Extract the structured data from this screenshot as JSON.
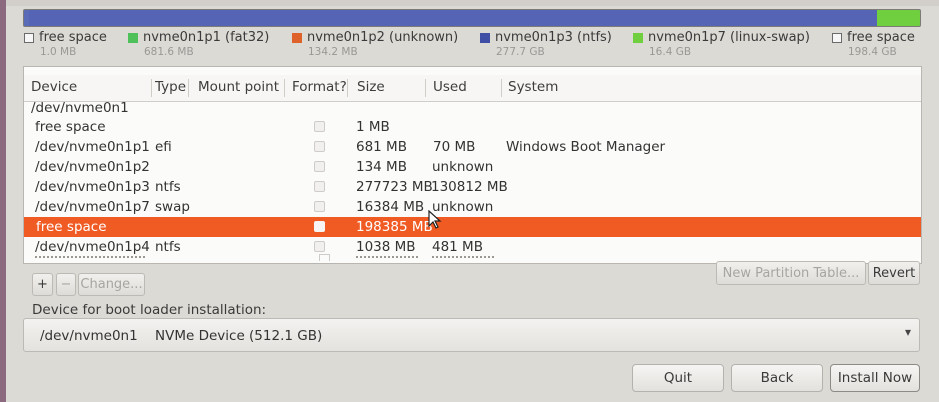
{
  "disk_bar": {
    "segments": [
      {
        "label": "free space",
        "size": "1.0 MB",
        "color": "#f5f5f5",
        "fraction": 0.002
      },
      {
        "label": "nvme0n1p1 (fat32)",
        "size": "681.6 MB",
        "color": "#4fc15a",
        "fraction": 0.002
      },
      {
        "label": "nvme0n1p2 (unknown)",
        "size": "134.2 MB",
        "color": "#e0622b",
        "fraction": 0.001
      },
      {
        "label": "nvme0n1p3 (ntfs)",
        "size": "277.7 GB",
        "color": "#3f4fa6",
        "fraction": 0.946
      },
      {
        "label": "nvme0n1p7 (linux-swap)",
        "size": "16.4 GB",
        "color": "#6fcf3f",
        "fraction": 0.049
      }
    ]
  },
  "legend": [
    {
      "label": "free space",
      "size": "1.0 MB",
      "color": "#f6f6f6"
    },
    {
      "label": "nvme0n1p1 (fat32)",
      "size": "681.6 MB",
      "color": "#4fc15a"
    },
    {
      "label": "nvme0n1p2 (unknown)",
      "size": "134.2 MB",
      "color": "#e0622b"
    },
    {
      "label": "nvme0n1p3 (ntfs)",
      "size": "277.7 GB",
      "color": "#3f4fa6"
    },
    {
      "label": "nvme0n1p7 (linux-swap)",
      "size": "16.4 GB",
      "color": "#6fcf3f"
    },
    {
      "label": "free space",
      "size": "198.4 GB",
      "color": "#f6f6f6"
    }
  ],
  "table": {
    "headers": {
      "device": "Device",
      "type": "Type",
      "mount": "Mount point",
      "format": "Format?",
      "size": "Size",
      "used": "Used",
      "system": "System"
    },
    "group": "/dev/nvme0n1",
    "rows": [
      {
        "device": "free space",
        "type": "",
        "size": "1 MB",
        "used": "",
        "system": ""
      },
      {
        "device": "/dev/nvme0n1p1",
        "type": "efi",
        "size": "681 MB",
        "used": "70 MB",
        "system": "Windows Boot Manager"
      },
      {
        "device": "/dev/nvme0n1p2",
        "type": "",
        "size": "134 MB",
        "used": "unknown",
        "system": ""
      },
      {
        "device": "/dev/nvme0n1p3",
        "type": "ntfs",
        "size": "277723 MB",
        "used": "130812 MB",
        "system": ""
      },
      {
        "device": "/dev/nvme0n1p7",
        "type": "swap",
        "size": "16384 MB",
        "used": "unknown",
        "system": ""
      },
      {
        "device": "free space",
        "type": "",
        "size": "198385 MB",
        "used": "",
        "system": "",
        "selected": true
      },
      {
        "device": "/dev/nvme0n1p4",
        "type": "ntfs",
        "size": "1038 MB",
        "used": "481 MB",
        "system": ""
      }
    ]
  },
  "toolbar": {
    "add": "+",
    "remove": "−",
    "change": "Change...",
    "new_table": "New Partition Table...",
    "revert": "Revert"
  },
  "bootloader": {
    "label": "Device for boot loader installation:",
    "device": "/dev/nvme0n1",
    "description": "NVMe Device (512.1 GB)"
  },
  "buttons": {
    "quit": "Quit",
    "back": "Back",
    "install": "Install Now"
  },
  "icons": {
    "dropdown": "chevron-down-icon",
    "pointer": "mouse-cursor-icon"
  }
}
